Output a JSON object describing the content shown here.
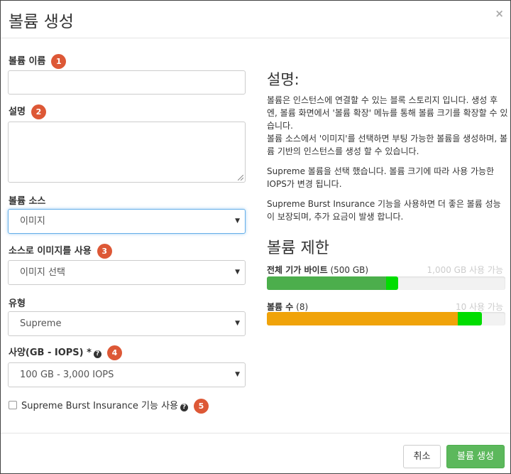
{
  "dialog": {
    "title": "볼륨 생성",
    "close_label": "×"
  },
  "form": {
    "name_label": "볼륨 이름",
    "name_badge": "1",
    "name_value": "",
    "desc_label": "설명",
    "desc_badge": "2",
    "desc_value": "",
    "source_label": "볼륨 소스",
    "source_value": "이미지",
    "use_image_label": "소스로 이미지를 사용",
    "use_image_badge": "3",
    "use_image_value": "이미지 선택",
    "type_label": "유형",
    "type_value": "Supreme",
    "spec_label": "사양(GB - IOPS) *",
    "spec_badge": "4",
    "spec_value": "100 GB - 3,000 IOPS",
    "burst_label": "Supreme Burst Insurance 기능 사용",
    "burst_badge": "5",
    "burst_checked": false,
    "help_glyph": "?",
    "select_arrow": "▼"
  },
  "description": {
    "heading": "설명:",
    "para1": "볼륨은 인스턴스에 연결할 수 있는 블록 스토리지 입니다. 생성 후엔, 볼륨 화면에서 '볼륨 확장' 메뉴를 통해 볼륨 크기를 확장할 수 있습니다.",
    "para2": "볼륨 소스에서 '이미지'를 선택하면 부팅 가능한 볼륨을 생성하며, 볼륨 기반의 인스턴스를 생성 할 수 있습니다.",
    "para3": "Supreme 볼륨을 선택 했습니다. 볼륨 크기에 따라 사용 가능한 IOPS가 변경 됩니다.",
    "para4": "Supreme Burst Insurance 기능을 사용하면 더 좋은 볼륨 성능이 보장되며, 추가 요금이 발생 합니다."
  },
  "limits": {
    "heading": "볼륨 제한",
    "gb_label": "전체 기가 바이트",
    "gb_value": "(500 GB)",
    "gb_available": "1,000 GB 사용 가능",
    "gb_used_fraction": 0.5,
    "gb_added_fraction": 0.05,
    "count_label": "볼륨 수",
    "count_value": "(8)",
    "count_available": "10 사용 가능",
    "count_used_fraction": 0.8,
    "count_added_fraction": 0.1,
    "colors": {
      "used_gb": "#4cae4c",
      "added": "#00dd00",
      "used_count": "#f0a30a"
    }
  },
  "footer": {
    "cancel_label": "취소",
    "create_label": "볼륨 생성"
  }
}
